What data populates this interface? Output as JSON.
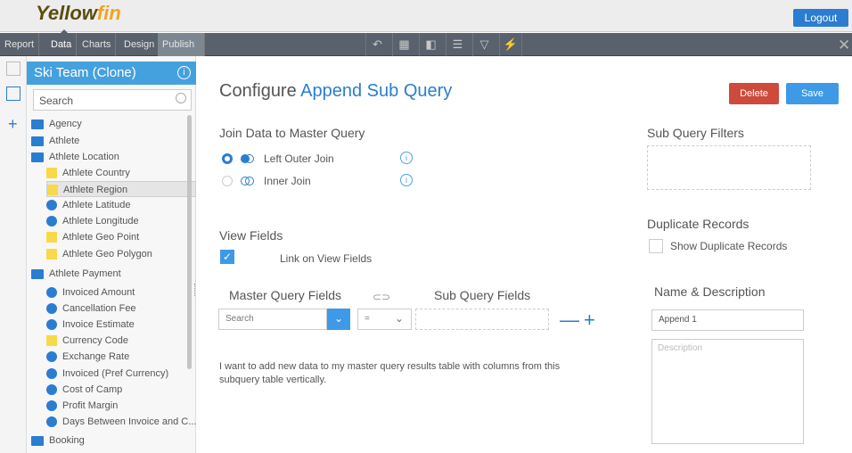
{
  "header": {
    "logo_part1": "Y",
    "logo_part2": "ellow",
    "logo_part3": "fin",
    "logout_label": "Logout"
  },
  "menu": {
    "tabs": [
      {
        "label": "Report"
      },
      {
        "label": "Data"
      },
      {
        "label": "Charts"
      },
      {
        "label": "Design"
      },
      {
        "label": "Publish"
      }
    ],
    "tools": [
      "undo-icon",
      "table-icon",
      "column-icon",
      "list-icon",
      "filter-icon",
      "lightning-icon"
    ],
    "close_label": "✕"
  },
  "sidebar": {
    "title": "Ski Team (Clone)",
    "info_label": "i",
    "search_placeholder": "Search",
    "items": [
      {
        "label": "Agency",
        "kind": "folder"
      },
      {
        "label": "Athlete",
        "kind": "folder"
      },
      {
        "label": "Athlete Location",
        "kind": "folder"
      },
      {
        "label": "Athlete Country",
        "kind": "dimension"
      },
      {
        "label": "Athlete Region",
        "kind": "dimension",
        "selected": true
      },
      {
        "label": "Athlete Latitude",
        "kind": "metric"
      },
      {
        "label": "Athlete Longitude",
        "kind": "metric"
      },
      {
        "label": "Athlete Geo Point",
        "kind": "dimension"
      },
      {
        "label": "Athlete Geo Polygon",
        "kind": "dimension"
      },
      {
        "label": "Athlete Payment",
        "kind": "folder"
      },
      {
        "label": "Invoiced Amount",
        "kind": "metric"
      },
      {
        "label": "Cancellation Fee",
        "kind": "metric"
      },
      {
        "label": "Invoice Estimate",
        "kind": "metric"
      },
      {
        "label": "Currency Code",
        "kind": "dimension"
      },
      {
        "label": "Exchange Rate",
        "kind": "metric"
      },
      {
        "label": "Invoiced (Pref Currency)",
        "kind": "metric"
      },
      {
        "label": "Cost of Camp",
        "kind": "metric"
      },
      {
        "label": "Profit Margin",
        "kind": "metric"
      },
      {
        "label": "Days Between Invoice and C...",
        "kind": "metric"
      },
      {
        "label": "Booking",
        "kind": "folder"
      }
    ]
  },
  "main": {
    "title_prefix": "Configure ",
    "title_highlight": "Append Sub Query",
    "delete_label": "Delete",
    "save_label": "Save",
    "join_heading": "Join Data to Master Query",
    "join_options": [
      {
        "label": "Left Outer Join",
        "selected": true
      },
      {
        "label": "Inner Join",
        "selected": false
      }
    ],
    "info_label": "i",
    "view_fields_heading": "View Fields",
    "link_view_fields_label": "Link on View Fields",
    "link_view_fields_checked": true,
    "check_mark": "✓",
    "master_fields_heading": "Master Query Fields",
    "sub_fields_heading": "Sub Query Fields",
    "master_search_placeholder": "Search",
    "operator_value": "=",
    "chevron": "⌄",
    "minus_label": "—",
    "plus_label": "+",
    "description_text": "I want to add new data to my master query results table with columns from this subquery table vertically."
  },
  "right": {
    "filters_heading": "Sub Query Filters",
    "duplicate_heading": "Duplicate Records",
    "show_duplicates_label": "Show Duplicate Records",
    "show_duplicates_checked": false,
    "name_desc_heading": "Name & Description",
    "name_value": "Append 1",
    "description_placeholder": "Description"
  },
  "colors": {
    "accent": "#2a7dd1",
    "delete": "#cd4a3c",
    "save": "#3e99e6",
    "menubar": "#59626c",
    "sidebar_title": "#45a1de"
  }
}
